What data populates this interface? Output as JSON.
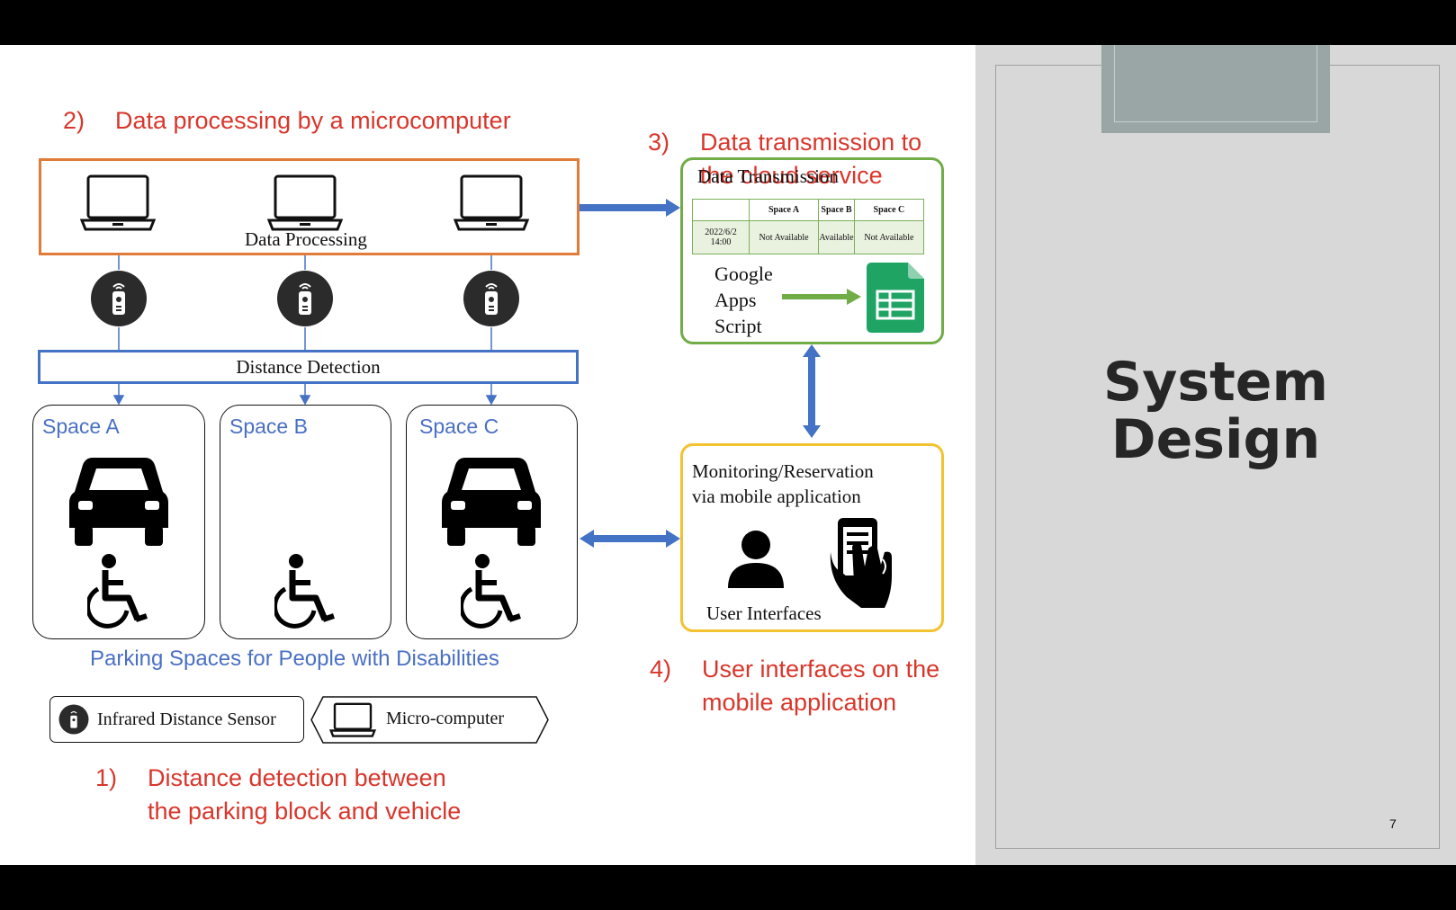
{
  "steps": {
    "s1": {
      "num": "1)",
      "line1": "Distance detection between",
      "line2": "the parking block and vehicle"
    },
    "s2": {
      "num": "2)",
      "line1": "Data processing by a microcomputer"
    },
    "s3": {
      "num": "3)",
      "line1": "Data transmission to",
      "line2": "the cloud service"
    },
    "s4": {
      "num": "4)",
      "line1": "User interfaces on the",
      "line2": "mobile application"
    }
  },
  "processing": {
    "label": "Data Processing"
  },
  "detection": {
    "label": "Distance Detection"
  },
  "spaces": [
    {
      "label": "Space A",
      "has_car": true
    },
    {
      "label": "Space B",
      "has_car": false
    },
    {
      "label": "Space C",
      "has_car": true
    }
  ],
  "parking_caption": "Parking Spaces for People with Disabilities",
  "legend": {
    "sensor": "Infrared Distance Sensor",
    "micro": "Micro-computer"
  },
  "transmission": {
    "title": "Data Transmission",
    "table": {
      "headers": [
        "",
        "Space A",
        "Space B",
        "Space C"
      ],
      "row": [
        "2022/6/2 14:00",
        "Not Available",
        "Available",
        "Not Available"
      ]
    },
    "gas_line1": "Google",
    "gas_line2": "Apps",
    "gas_line3": "Script"
  },
  "monitoring": {
    "line1": "Monitoring/Reservation",
    "line2": "via mobile application",
    "ui_label": "User Interfaces"
  },
  "slide": {
    "title_line1": "System",
    "title_line2": "Design",
    "page": "7"
  },
  "colors": {
    "red": "#d8362b",
    "orange": "#e07b39",
    "blue": "#4472c4",
    "green": "#70ad47",
    "yellow": "#f3c230",
    "gray_panel": "#d8d8d8"
  }
}
